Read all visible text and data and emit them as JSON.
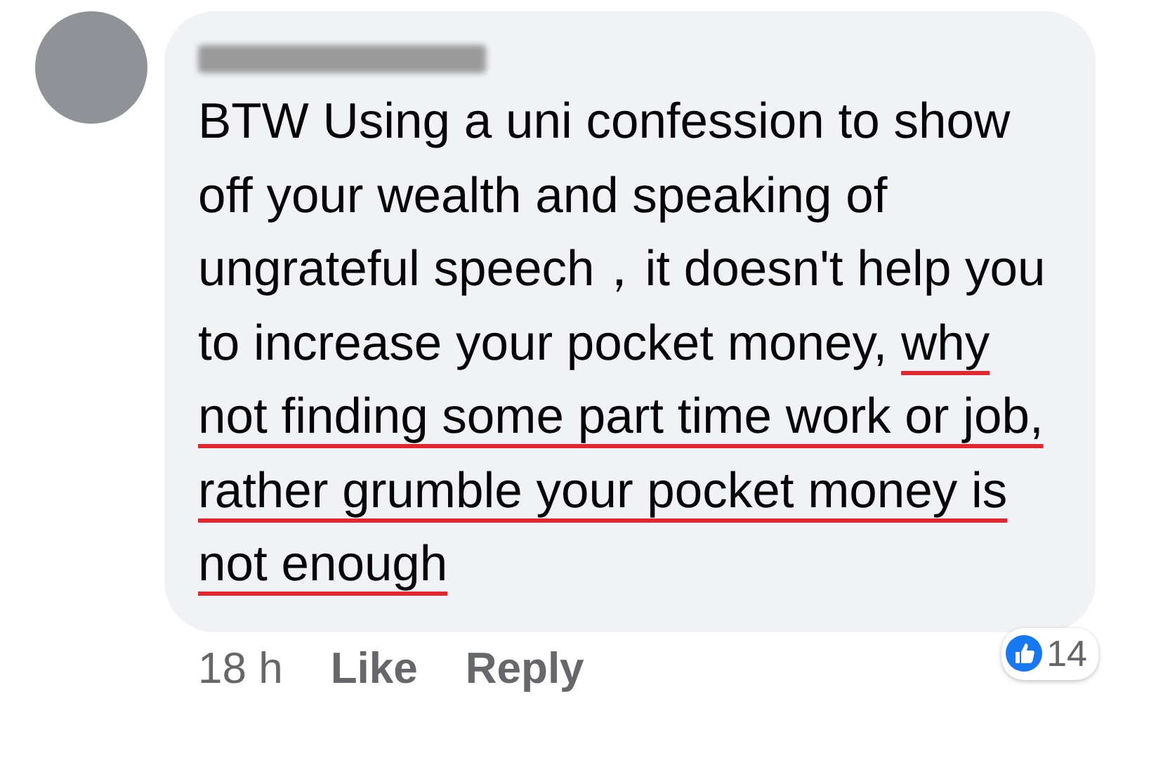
{
  "comment": {
    "body": [
      {
        "text": "BTW Using a uni confession to show off your wealth and speaking of ungrateful speech，it doesn't help you to increase your pocket money, ",
        "underlined": false
      },
      {
        "text": "why not finding some part time work or job, rather grumble your pocket money is not enough",
        "underlined": true
      }
    ],
    "reactions": {
      "count": "14"
    },
    "footer": {
      "time": "18 h",
      "actions": [
        "Like",
        "Reply"
      ]
    }
  }
}
